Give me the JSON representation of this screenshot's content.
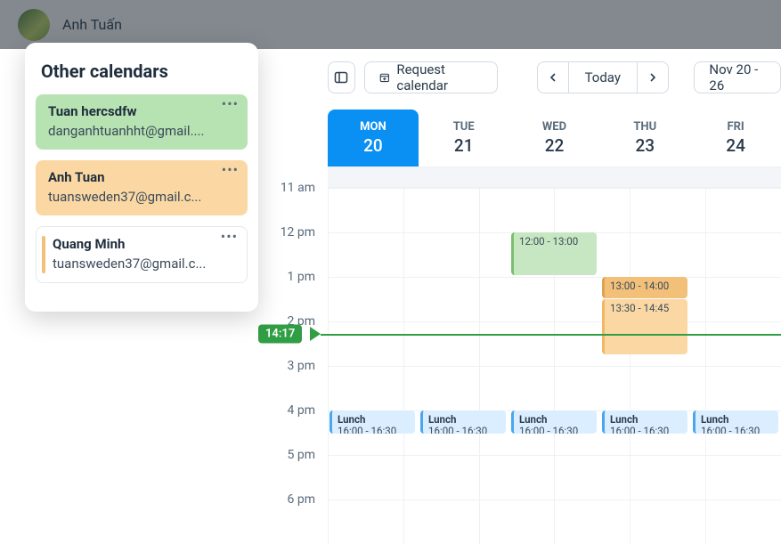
{
  "topbar": {
    "user_name": "Anh Tuấn"
  },
  "panel": {
    "title": "Other calendars",
    "calendars": [
      {
        "name": "Tuan hercsdfw",
        "email": "danganhtuanhht@gmail....",
        "color": "green"
      },
      {
        "name": "Anh Tuan",
        "email": "tuansweden37@gmail.c...",
        "color": "orange"
      },
      {
        "name": "Quang Minh",
        "email": "tuansweden37@gmail.c...",
        "color": "white"
      }
    ]
  },
  "toolbar": {
    "request_label": "Request calendar",
    "today_label": "Today",
    "range_label": "Nov 20 - 26"
  },
  "days": [
    {
      "dow": "MON",
      "num": "20",
      "active": true
    },
    {
      "dow": "TUE",
      "num": "21",
      "active": false
    },
    {
      "dow": "WED",
      "num": "22",
      "active": false
    },
    {
      "dow": "THU",
      "num": "23",
      "active": false
    },
    {
      "dow": "FRI",
      "num": "24",
      "active": false
    }
  ],
  "hours": [
    "11 am",
    "12 pm",
    "1 pm",
    "2 pm",
    "3 pm",
    "4 pm",
    "5 pm",
    "6 pm"
  ],
  "now": {
    "label": "14:17"
  },
  "events": {
    "wed_green": {
      "time": "12:00 - 13:00"
    },
    "thu_top": {
      "time": "13:00 - 14:00"
    },
    "thu_body": {
      "time": "13:30 - 14:45"
    },
    "lunch": {
      "title": "Lunch",
      "time": "16:00 - 16:30"
    }
  }
}
